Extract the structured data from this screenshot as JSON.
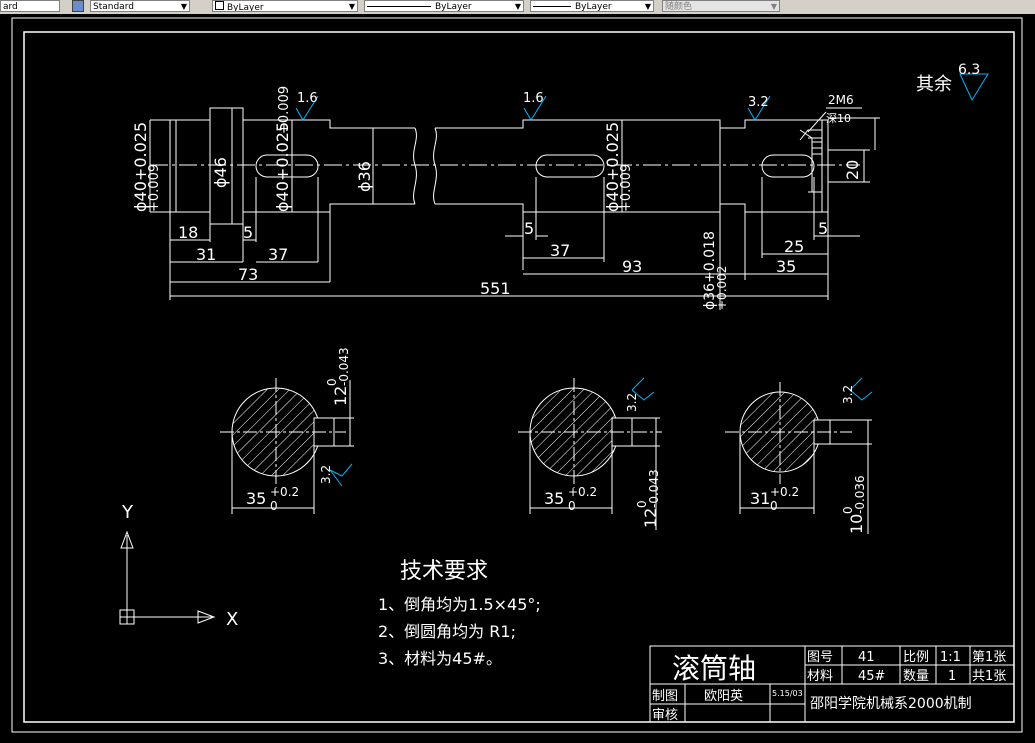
{
  "toolbar": {
    "textstyle_tail": "ard",
    "textstyle": "Standard",
    "layer": "ByLayer",
    "linetype": "ByLayer",
    "lineweight": "ByLayer",
    "plotstyle": "随颜色"
  },
  "colors": {
    "line": "#ffffff",
    "roughness": "#00b4ff",
    "background": "#000000"
  },
  "drawing": {
    "roughness_other_label": "其余",
    "roughness_other_value": "6.3",
    "roughness": [
      "1.6",
      "1.6",
      "3.2"
    ],
    "thread": "2M6",
    "thread_depth": "深10",
    "diameters": [
      "ϕ40+0.025",
      "+0.009",
      "ϕ46",
      "ϕ40+0.025",
      "+0.009",
      "ϕ36",
      "ϕ40+0.025",
      "+0.009"
    ],
    "right_dim": "20",
    "bottom_dims": [
      "18",
      "5",
      "31",
      "37",
      "73",
      "5",
      "37",
      "93",
      "25",
      "5",
      "35",
      "551"
    ],
    "phi36_dim": "ϕ36+0.018",
    "phi36_tol": "+0.002",
    "sections": [
      {
        "width": "35",
        "width_tol_upper": "+0.2",
        "width_tol_lower": "0",
        "key": "12",
        "key_tol_upper": "0",
        "key_tol_lower": "-0.043",
        "rough": "3.2"
      },
      {
        "width": "35",
        "width_tol_upper": "+0.2",
        "width_tol_lower": "0",
        "key": "12",
        "key_tol_upper": "0",
        "key_tol_lower": "-0.043",
        "rough": "3.2"
      },
      {
        "width": "31",
        "width_tol_upper": "+0.2",
        "width_tol_lower": "0",
        "key": "10",
        "key_tol_upper": "0",
        "key_tol_lower": "-0.036",
        "rough": "3.2"
      }
    ],
    "ucs_x": "X",
    "ucs_y": "Y"
  },
  "requirements": {
    "title": "技术要求",
    "items": [
      "1、倒角均为1.5×45°;",
      "2、倒圆角均为  R1;",
      "3、材料为45#。"
    ]
  },
  "title_block": {
    "part_name": "滚筒轴",
    "drawing_no_label": "图号",
    "drawing_no": "41",
    "scale_label": "比例",
    "scale": "1:1",
    "sheet": "第1张",
    "material_label": "材料",
    "material": "45#",
    "qty_label": "数量",
    "qty": "1",
    "total_sheets": "共1张",
    "drawn_label": "制图",
    "drawn_by": "欧阳英",
    "date": "5.15/03",
    "school": "邵阳学院机械系2000机制",
    "review_label": "审核"
  }
}
